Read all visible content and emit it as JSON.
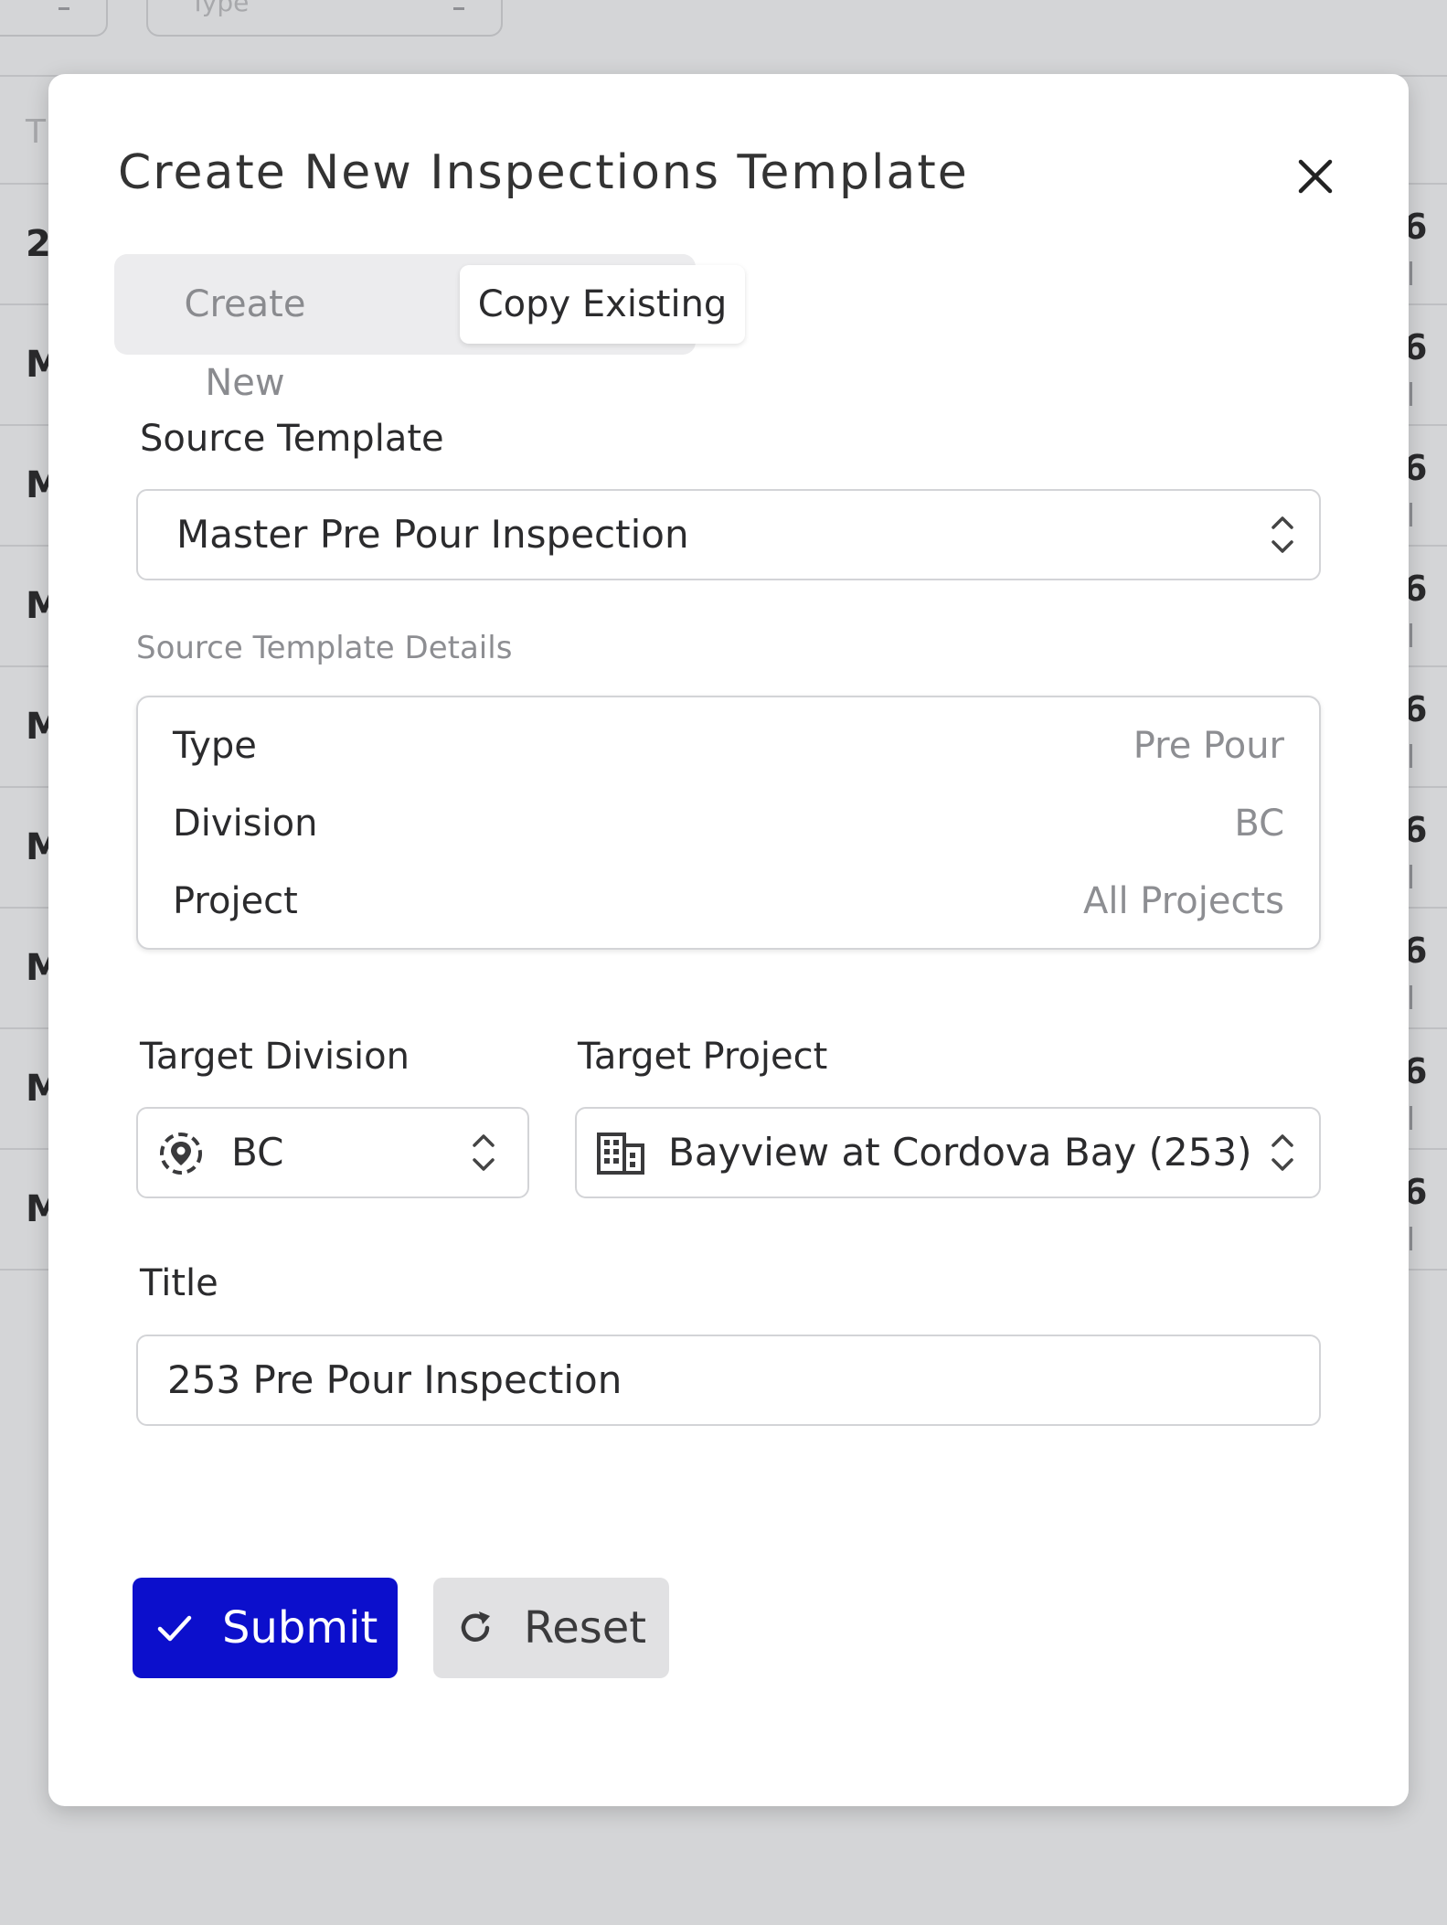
{
  "background": {
    "filters": [
      {
        "placeholder": ""
      },
      {
        "placeholder": "Type"
      }
    ],
    "table": {
      "header_left": "T",
      "rows": [
        {
          "left": "2",
          "right": "6"
        },
        {
          "left": "M",
          "right": "6"
        },
        {
          "left": "M",
          "right": "6"
        },
        {
          "left": "M",
          "right": "6"
        },
        {
          "left": "M",
          "right": "6"
        },
        {
          "left": "M",
          "right": "6"
        },
        {
          "left": "M",
          "right": "6"
        },
        {
          "left": "M",
          "right": "6"
        },
        {
          "left": "M",
          "right": "6"
        }
      ]
    }
  },
  "modal": {
    "title": "Create New Inspections Template",
    "tabs": {
      "create_new": "Create New",
      "copy_existing": "Copy Existing",
      "active": "Copy Existing"
    },
    "source_template": {
      "label": "Source Template",
      "value": "Master Pre Pour Inspection"
    },
    "details": {
      "label": "Source Template Details",
      "rows": [
        {
          "key": "Type",
          "value": "Pre Pour"
        },
        {
          "key": "Division",
          "value": "BC"
        },
        {
          "key": "Project",
          "value": "All Projects"
        }
      ]
    },
    "target_division": {
      "label": "Target Division",
      "value": "BC",
      "icon": "location-target-icon"
    },
    "target_project": {
      "label": "Target Project",
      "value": "Bayview at Cordova Bay (253)",
      "icon": "building-icon"
    },
    "title_field": {
      "label": "Title",
      "value": "253 Pre Pour Inspection"
    },
    "buttons": {
      "submit": "Submit",
      "reset": "Reset"
    }
  },
  "colors": {
    "primary": "#0c0fcc",
    "overlay": "#d4d5d7"
  }
}
